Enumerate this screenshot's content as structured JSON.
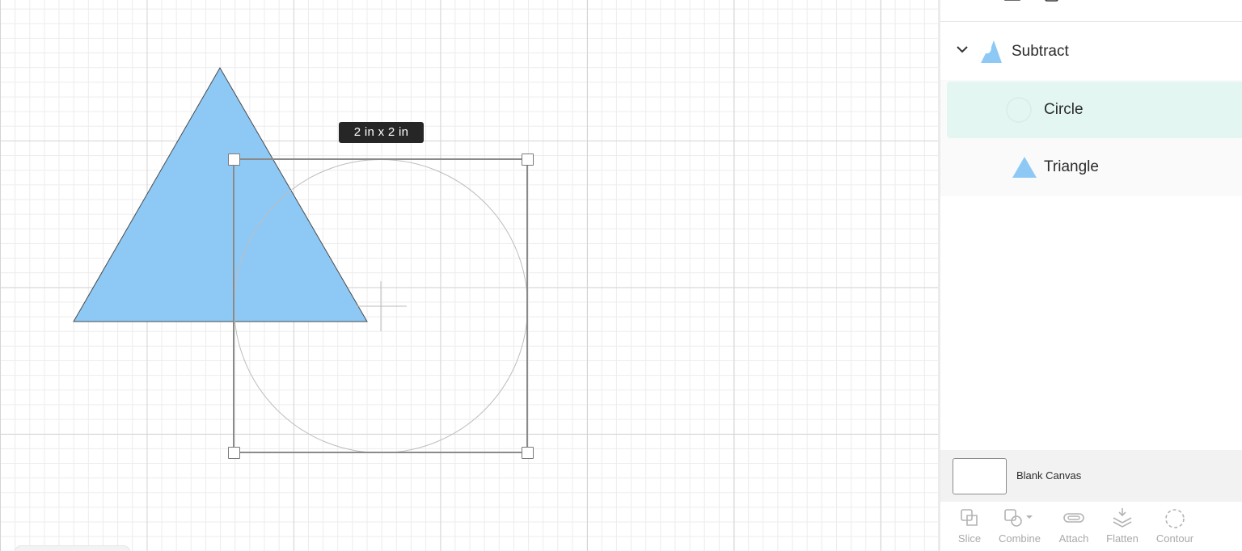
{
  "canvas": {
    "size_tooltip": "2  in x 2  in",
    "colors": {
      "triangle_fill": "#8ec9f5",
      "selection_stroke": "#7a7a7a",
      "grid_major": "#d4d4d4",
      "grid_minor": "#ececec"
    }
  },
  "layers": {
    "group": {
      "label": "Subtract",
      "expanded": true,
      "icon": "subtract-shape-icon"
    },
    "items": [
      {
        "label": "Circle",
        "icon": "circle-outline-icon",
        "selected": true
      },
      {
        "label": "Triangle",
        "icon": "triangle-icon",
        "selected": false
      }
    ]
  },
  "blank_canvas": {
    "label": "Blank Canvas"
  },
  "actions": [
    {
      "label": "Slice",
      "icon": "slice-icon"
    },
    {
      "label": "Combine",
      "icon": "combine-icon"
    },
    {
      "label": "Attach",
      "icon": "attach-icon"
    },
    {
      "label": "Flatten",
      "icon": "flatten-icon"
    },
    {
      "label": "Contour",
      "icon": "contour-icon"
    }
  ],
  "theme": {
    "selected_row": "#e3f6f1",
    "action_disabled": "#a9a9a9"
  }
}
